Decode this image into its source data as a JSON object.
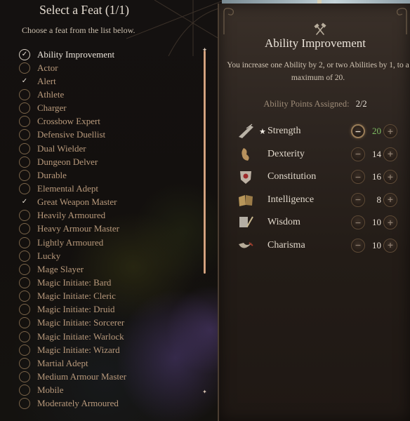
{
  "left_panel": {
    "title": "Select a Feat (1/1)",
    "subtitle": "Choose a feat from the list below.",
    "feats": [
      {
        "label": "Ability Improvement",
        "state": "selected"
      },
      {
        "label": "Actor",
        "state": "available"
      },
      {
        "label": "Alert",
        "state": "taken"
      },
      {
        "label": "Athlete",
        "state": "available"
      },
      {
        "label": "Charger",
        "state": "available"
      },
      {
        "label": "Crossbow Expert",
        "state": "available"
      },
      {
        "label": "Defensive Duellist",
        "state": "available"
      },
      {
        "label": "Dual Wielder",
        "state": "available"
      },
      {
        "label": "Dungeon Delver",
        "state": "available"
      },
      {
        "label": "Durable",
        "state": "available"
      },
      {
        "label": "Elemental Adept",
        "state": "available"
      },
      {
        "label": "Great Weapon Master",
        "state": "taken"
      },
      {
        "label": "Heavily Armoured",
        "state": "available"
      },
      {
        "label": "Heavy Armour Master",
        "state": "available"
      },
      {
        "label": "Lightly Armoured",
        "state": "available"
      },
      {
        "label": "Lucky",
        "state": "available"
      },
      {
        "label": "Mage Slayer",
        "state": "available"
      },
      {
        "label": "Magic Initiate: Bard",
        "state": "available"
      },
      {
        "label": "Magic Initiate: Cleric",
        "state": "available"
      },
      {
        "label": "Magic Initiate: Druid",
        "state": "available"
      },
      {
        "label": "Magic Initiate: Sorcerer",
        "state": "available"
      },
      {
        "label": "Magic Initiate: Warlock",
        "state": "available"
      },
      {
        "label": "Magic Initiate: Wizard",
        "state": "available"
      },
      {
        "label": "Martial Adept",
        "state": "available"
      },
      {
        "label": "Medium Armour Master",
        "state": "available"
      },
      {
        "label": "Mobile",
        "state": "available"
      },
      {
        "label": "Moderately Armoured",
        "state": "available"
      }
    ],
    "glyphs": {
      "selected": "✓",
      "taken": "✓",
      "scroll_cap": "✦"
    }
  },
  "detail_panel": {
    "icon": "crossed-hammers-icon",
    "title": "Ability Improvement",
    "description": "You increase one Ability by 2, or two Abilities by 1, to a maximum of 20.",
    "points_label": "Ability Points Assigned:",
    "points_value": "2/2",
    "minus_glyph": "−",
    "plus_glyph": "+",
    "star_glyph": "★",
    "abilities": [
      {
        "name": "Strength",
        "value": "20",
        "starred": true,
        "at_max": true,
        "icon": "strength-icon"
      },
      {
        "name": "Dexterity",
        "value": "14",
        "starred": false,
        "at_max": false,
        "icon": "dexterity-icon"
      },
      {
        "name": "Constitution",
        "value": "16",
        "starred": false,
        "at_max": false,
        "icon": "constitution-icon"
      },
      {
        "name": "Intelligence",
        "value": "8",
        "starred": false,
        "at_max": false,
        "icon": "intelligence-icon"
      },
      {
        "name": "Wisdom",
        "value": "10",
        "starred": false,
        "at_max": false,
        "icon": "wisdom-icon"
      },
      {
        "name": "Charisma",
        "value": "10",
        "starred": false,
        "at_max": false,
        "icon": "charisma-icon"
      }
    ]
  },
  "colors": {
    "max_value": "#7fbf63",
    "feat_text": "#b99a7c",
    "feat_text_active": "#ece5db",
    "scrollbar": "#d6a47f"
  }
}
